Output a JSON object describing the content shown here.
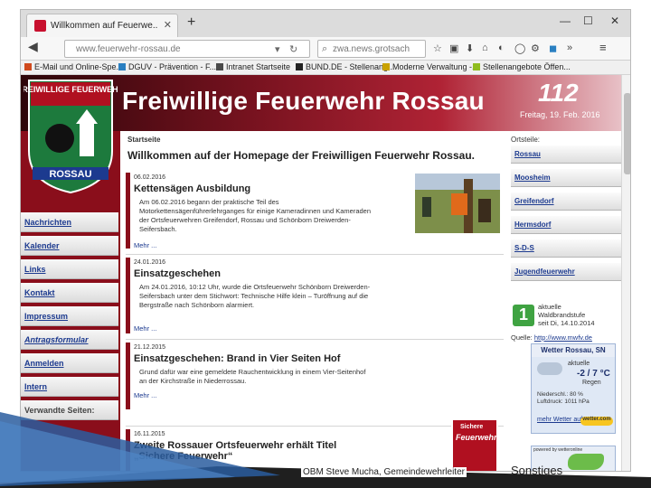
{
  "browser": {
    "tab_title": "Willkommen auf Feuerwe...",
    "url": "www.feuerwehr-rossau.de",
    "search_text": "zwa.news.grotsach",
    "window_controls": {
      "minimize": "—",
      "maximize": "☐",
      "close": "✕"
    },
    "bookmarks": [
      {
        "label": "E-Mail und Online-Spe...",
        "color": "#d04a1e"
      },
      {
        "label": "DGUV - Prävention - F...",
        "color": "#2a7fc1"
      },
      {
        "label": "Intranet Startseite",
        "color": "#4a4a4a"
      },
      {
        "label": "BUND.DE - Stellenang...",
        "color": "#222222"
      },
      {
        "label": "Moderne Verwaltung -...",
        "color": "#c9a200"
      },
      {
        "label": "Stellenangebote Öffen...",
        "color": "#8fbc1e"
      }
    ]
  },
  "site": {
    "header_title": "Freiwillige Feuerwehr Rossau",
    "emergency_number": "112",
    "header_date": "Freitag, 19. Feb. 2016",
    "crest_top": "FREIWILLIGE FEUERWEHR",
    "crest_bottom": "ROSSAU",
    "breadcrumb": "Startseite",
    "welcome": "Willkommen auf der Homepage der Freiwilligen Feuerwehr Rossau.",
    "menu": [
      "Nachrichten",
      "Kalender",
      "Links",
      "Kontakt",
      "Impressum",
      "Antragsformular",
      "Anmelden",
      "Intern",
      "Verwandte Seiten:"
    ],
    "news": [
      {
        "date": "06.02.2016",
        "title": "Kettensägen Ausbildung",
        "text": "Am 06.02.2016 begann der praktische Teil des Motorkettensägenführerlehrganges für einige Kameradinnen und Kameraden der Ortsfeuerwehren Greifendorf, Rossau und Schönborn Dreiwerden-Seifersbach.",
        "more": "Mehr ..."
      },
      {
        "date": "24.01.2016",
        "title": "Einsatzgeschehen",
        "text": "Am 24.01.2016, 10:12 Uhr, wurde die Ortsfeuerwehr Schönborn Dreiwerden-Seifersbach unter dem Stichwort: Technische Hilfe klein – Turöffnung auf die Bergstraße nach Schönborn alarmiert.",
        "more": "Mehr ..."
      },
      {
        "date": "21.12.2015",
        "title": "Einsatzgeschehen: Brand in Vier Seiten Hof",
        "text": "Grund dafür war eine gemeldete Rauchentwicklung in einem Vier-Seitenhof an der Kirchstraße in Niederrossau.",
        "more": "Mehr ..."
      },
      {
        "date": "16.11.2015",
        "title": "Zweite Rossauer Ortsfeuerwehr erhält Titel „Sichere Feuerwehr“",
        "text": "",
        "more": ""
      }
    ],
    "badge_small": "Sichere",
    "badge_big": "Feuerwehr",
    "right": {
      "heading": "Ortsteile:",
      "buttons": [
        "Rossau",
        "Moosheim",
        "Greifendorf",
        "Hermsdorf",
        "S-D-S",
        "Jugendfeuerwehr"
      ],
      "warning_level": "1",
      "warning_lines": [
        "aktuelle",
        "Waldbrandstufe",
        "seit Di, 14.10.2014"
      ],
      "source_label": "Quelle:",
      "source_link": "http://www.mwfv.de",
      "weather": {
        "title": "Wetter Rossau, SN",
        "label": "aktuelle",
        "temp": "-2 / 7 °C",
        "desc": "Regen",
        "stats": [
          "Niederschl.: 80 %",
          "Luftdruck: 1011 hPa"
        ],
        "more_link": "mehr Wetter auf",
        "brand": "wetter.com"
      },
      "map_caption": "powered by wetteronline"
    }
  },
  "slide": {
    "footer": "OBM Steve Mucha, Gemeindewehrleiter",
    "extra": "Sonstiges"
  }
}
